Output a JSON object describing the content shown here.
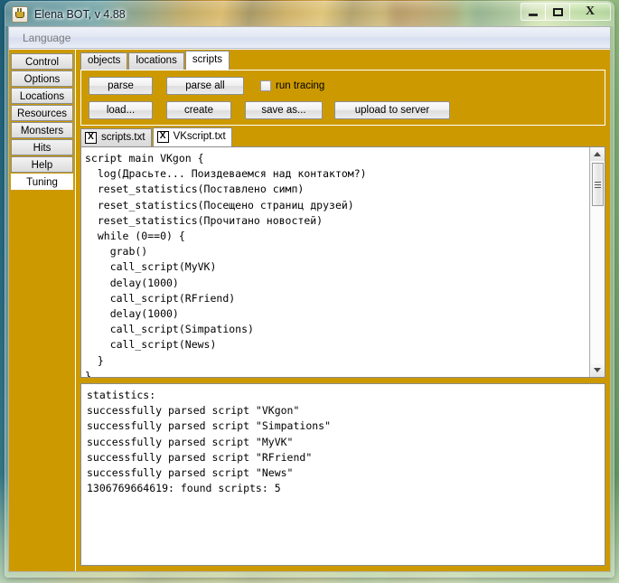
{
  "window": {
    "title": "Elena BOT, v 4.88",
    "icon": "java-coffee-cup-icon",
    "buttons": {
      "minimize": "–",
      "maximize": "□",
      "close": "X"
    }
  },
  "menubar": {
    "items": [
      {
        "label": "Language"
      }
    ]
  },
  "sidebar": {
    "items": [
      {
        "label": "Control",
        "selected": false
      },
      {
        "label": "Options",
        "selected": false
      },
      {
        "label": "Locations",
        "selected": false
      },
      {
        "label": "Resources",
        "selected": false
      },
      {
        "label": "Monsters",
        "selected": false
      },
      {
        "label": "Hits",
        "selected": false
      },
      {
        "label": "Help",
        "selected": false
      },
      {
        "label": "Tuning",
        "selected": true
      }
    ]
  },
  "tabs": {
    "items": [
      {
        "label": "objects",
        "active": false
      },
      {
        "label": "locations",
        "active": false
      },
      {
        "label": "scripts",
        "active": true
      }
    ]
  },
  "toolbar": {
    "parse_label": "parse",
    "parse_all_label": "parse all",
    "run_tracing_label": "run tracing",
    "run_tracing_checked": false,
    "load_label": "load...",
    "create_label": "create",
    "save_as_label": "save as...",
    "upload_label": "upload to server"
  },
  "file_tabs": {
    "close_glyph": "X",
    "items": [
      {
        "label": "scripts.txt",
        "active": false
      },
      {
        "label": "VKscript.txt",
        "active": true
      }
    ]
  },
  "editor": {
    "code": "script main VKgon {\n  log(Драсьте... Поиздеваемся над контактом?)\n  reset_statistics(Поставлено симп)\n  reset_statistics(Посещено страниц друзей)\n  reset_statistics(Прочитано новостей)\n  while (0==0) {\n    grab()\n    call_script(MyVK)\n    delay(1000)\n    call_script(RFriend)\n    delay(1000)\n    call_script(Simpations)\n    call_script(News)\n  }\n}",
    "scrollbar": {
      "up_arrow": "▲",
      "down_arrow": "▼"
    }
  },
  "output": {
    "text": "statistics:\nsuccessfully parsed script \"VKgon\"\nsuccessfully parsed script \"Simpations\"\nsuccessfully parsed script \"MyVK\"\nsuccessfully parsed script \"RFriend\"\nsuccessfully parsed script \"News\"\n1306769664619: found scripts: 5"
  },
  "colors": {
    "panel_orange": "#cc9a00",
    "selected_tab": "#ffffff",
    "editor_background": "#ffffff"
  }
}
